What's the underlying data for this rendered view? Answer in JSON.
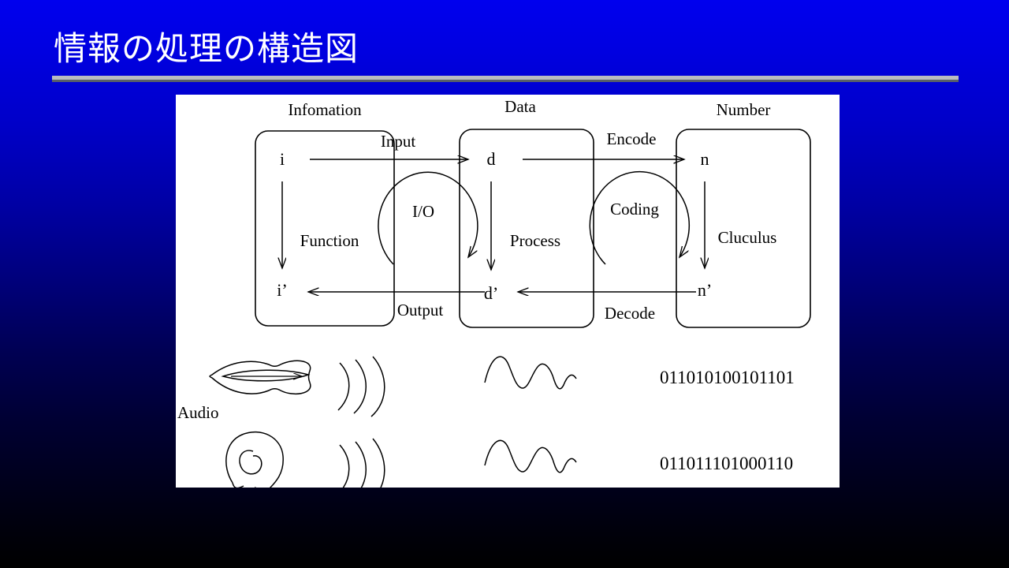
{
  "slide": {
    "title": "情報の処理の構造図",
    "background_top_color": "#0000ee",
    "background_bottom_color": "#000000",
    "rule_color": "#b9bcc0",
    "panel_color": "#ffffff"
  },
  "diagram": {
    "columns": [
      {
        "header": "Infomation",
        "top_var": "i",
        "bottom_var": "i’",
        "vertical_label": "Function"
      },
      {
        "header": "Data",
        "top_var": "d",
        "bottom_var": "d’",
        "vertical_label": "Process"
      },
      {
        "header": "Number",
        "top_var": "n",
        "bottom_var": "n’",
        "vertical_label": "Cluculus"
      }
    ],
    "transitions": [
      {
        "forward": "Input",
        "backward": "Output",
        "cycle": "I/O"
      },
      {
        "forward": "Encode",
        "backward": "Decode",
        "cycle": "Coding"
      }
    ],
    "media": {
      "audio_label": "Audio",
      "icons": [
        "mouth-icon",
        "ear-icon",
        "sound-wave-icon",
        "waveform-icon"
      ],
      "binary_rows": [
        "011010100101101",
        "011011101000110"
      ]
    }
  }
}
